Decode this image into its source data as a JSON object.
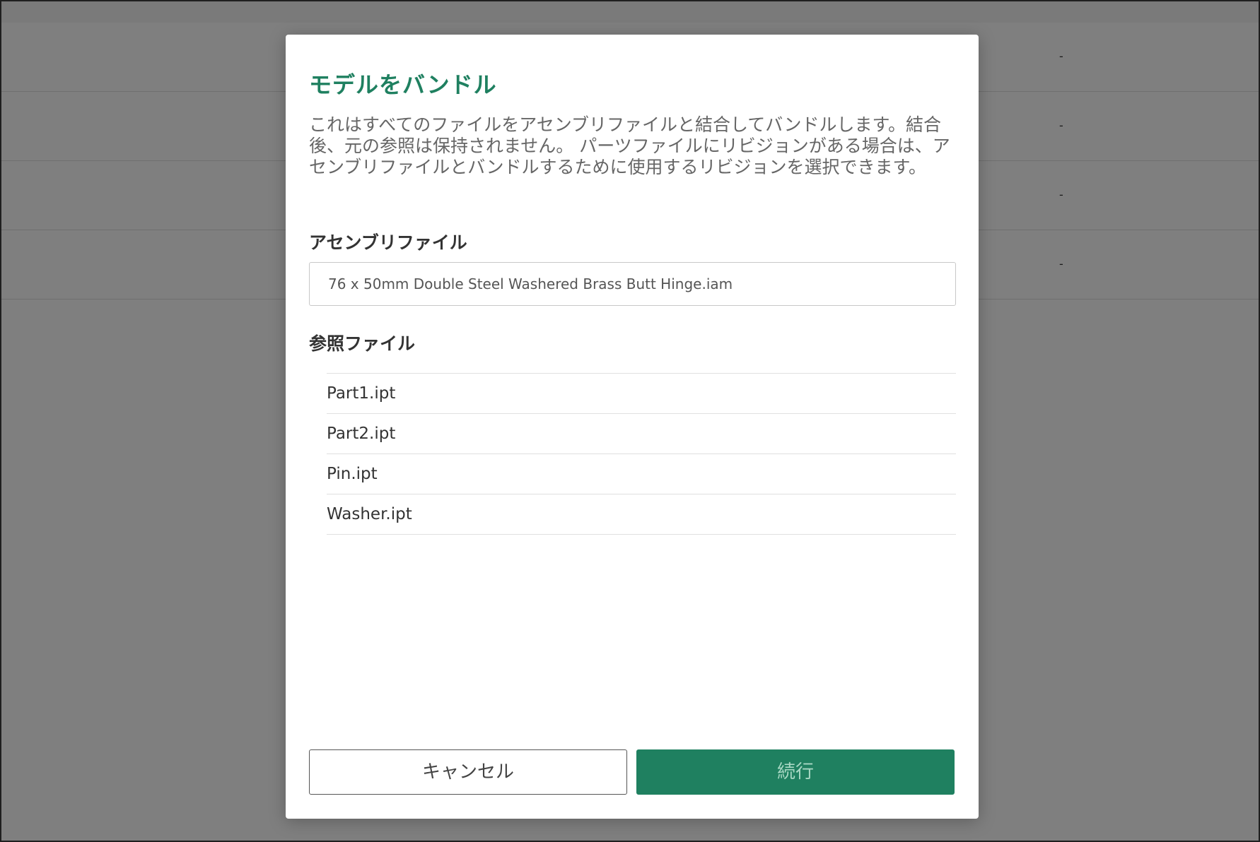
{
  "background": {
    "row_values": [
      "-",
      "-",
      "-",
      "-"
    ]
  },
  "modal": {
    "title": "モデルをバンドル",
    "description": "これはすべてのファイルをアセンブリファイルと結合してバンドルします。結合後、元の参照は保持されません。 パーツファイルにリビジョンがある場合は、アセンブリファイルとバンドルするために使用するリビジョンを選択できます。",
    "assembly_label": "アセンブリファイル",
    "assembly_value": "76 x 50mm Double Steel Washered Brass Butt Hinge.iam",
    "reference_label": "参照ファイル",
    "reference_files": [
      "Part1.ipt",
      "Part2.ipt",
      "Pin.ipt",
      "Washer.ipt"
    ],
    "cancel_label": "キャンセル",
    "continue_label": "続行"
  },
  "colors": {
    "accent": "#1f8060",
    "overlay": "#808080",
    "continue_text": "#a8d8c4"
  }
}
